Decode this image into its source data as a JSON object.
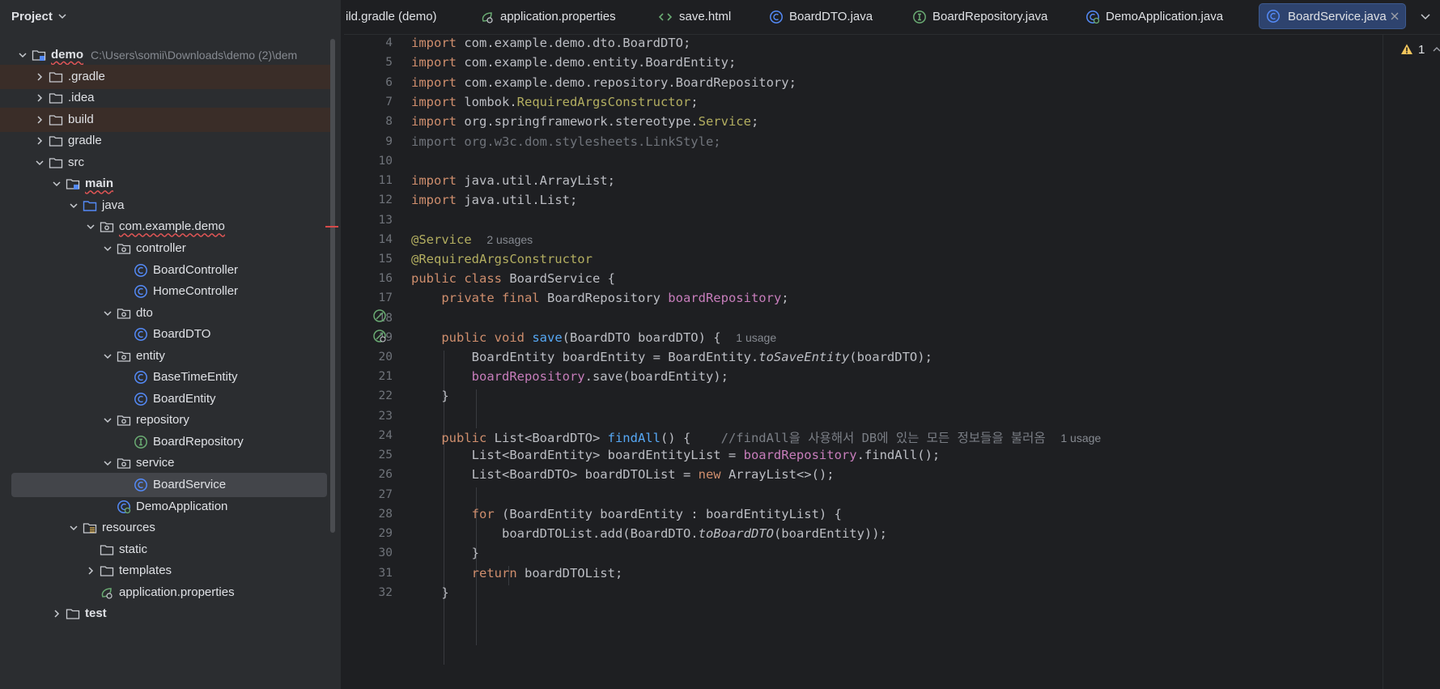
{
  "project_panel": {
    "title": "Project",
    "tree": [
      {
        "label": "demo",
        "path": "C:\\Users\\somii\\Downloads\\demo (2)\\dem",
        "icon": "module-folder-icon",
        "expanded": true
      },
      {
        "label": ".gradle",
        "icon": "folder-icon",
        "expanded": false
      },
      {
        "label": ".idea",
        "icon": "folder-icon",
        "expanded": false
      },
      {
        "label": "build",
        "icon": "folder-icon",
        "expanded": false
      },
      {
        "label": "gradle",
        "icon": "folder-icon",
        "expanded": false
      },
      {
        "label": "src",
        "icon": "folder-icon",
        "expanded": true
      },
      {
        "label": "main",
        "icon": "module-folder-icon",
        "expanded": true
      },
      {
        "label": "java",
        "icon": "source-folder-icon",
        "expanded": true
      },
      {
        "label": "com.example.demo",
        "icon": "package-icon",
        "expanded": true
      },
      {
        "label": "controller",
        "icon": "package-icon",
        "expanded": true
      },
      {
        "label": "BoardController",
        "icon": "class-icon"
      },
      {
        "label": "HomeController",
        "icon": "class-icon"
      },
      {
        "label": "dto",
        "icon": "package-icon",
        "expanded": true
      },
      {
        "label": "BoardDTO",
        "icon": "class-icon"
      },
      {
        "label": "entity",
        "icon": "package-icon",
        "expanded": true
      },
      {
        "label": "BaseTimeEntity",
        "icon": "class-icon"
      },
      {
        "label": "BoardEntity",
        "icon": "class-icon"
      },
      {
        "label": "repository",
        "icon": "package-icon",
        "expanded": true
      },
      {
        "label": "BoardRepository",
        "icon": "interface-icon"
      },
      {
        "label": "service",
        "icon": "package-icon",
        "expanded": true
      },
      {
        "label": "BoardService",
        "icon": "class-icon"
      },
      {
        "label": "DemoApplication",
        "icon": "spring-boot-class-icon"
      },
      {
        "label": "resources",
        "icon": "resources-folder-icon",
        "expanded": true
      },
      {
        "label": "static",
        "icon": "folder-icon"
      },
      {
        "label": "templates",
        "icon": "folder-icon",
        "expanded": false
      },
      {
        "label": "application.properties",
        "icon": "spring-properties-icon"
      },
      {
        "label": "test",
        "icon": "folder-icon",
        "expanded": false
      }
    ]
  },
  "tabs": [
    {
      "label": "ild.gradle (demo)",
      "icon": "gradle-icon"
    },
    {
      "label": "application.properties",
      "icon": "spring-properties-icon"
    },
    {
      "label": "save.html",
      "icon": "html-icon"
    },
    {
      "label": "BoardDTO.java",
      "icon": "class-icon"
    },
    {
      "label": "BoardRepository.java",
      "icon": "interface-icon"
    },
    {
      "label": "DemoApplication.java",
      "icon": "spring-boot-class-icon"
    },
    {
      "label": "BoardService.java",
      "icon": "class-icon",
      "active": true
    }
  ],
  "editor": {
    "line_numbers": [
      "4",
      "5",
      "6",
      "7",
      "8",
      "9",
      "10",
      "11",
      "12",
      "13",
      "14",
      "15",
      "16",
      "17",
      "18",
      "19",
      "20",
      "21",
      "22",
      "23",
      "24",
      "25",
      "26",
      "27",
      "28",
      "29",
      "30",
      "31",
      "32"
    ],
    "code": {
      "l4_kw": "import",
      "l4_rest": " com.example.demo.dto.BoardDTO;",
      "l5_kw": "import",
      "l5_rest": " com.example.demo.entity.BoardEntity;",
      "l6_kw": "import",
      "l6_rest": " com.example.demo.repository.BoardRepository;",
      "l7_kw": "import",
      "l7_a": " lombok.",
      "l7_b": "RequiredArgsConstructor",
      "l7_c": ";",
      "l8_kw": "import",
      "l8_a": " org.springframework.stereotype.",
      "l8_b": "Service",
      "l8_c": ";",
      "l9": "import org.w3c.dom.stylesheets.LinkStyle;",
      "l11_kw": "import",
      "l11_rest": " java.util.ArrayList;",
      "l12_kw": "import",
      "l12_rest": " java.util.List;",
      "l14_ann": "@Service",
      "l14_hint": "2 usages",
      "l15_ann": "@RequiredArgsConstructor",
      "l16_kw": "public class",
      "l16_rest": " BoardService {",
      "l17_kw": "private final",
      "l17_a": " BoardRepository ",
      "l17_fld": "boardRepository",
      "l17_c": ";",
      "l19_kw": "public void",
      "l19_fn": "save",
      "l19_rest": "(BoardDTO boardDTO) {",
      "l19_hint": "1 usage",
      "l20_a": "BoardEntity boardEntity = BoardEntity.",
      "l20_it": "toSaveEntity",
      "l20_c": "(boardDTO);",
      "l21_fld": "boardRepository",
      "l21_rest": ".save(boardEntity);",
      "l22": "}",
      "l24_kw": "public",
      "l24_a": " List<BoardDTO> ",
      "l24_fn": "findAll",
      "l24_b": "() {",
      "l24_cmt": "//findAll을 사용해서 DB에 있는 모든 정보들을 불러옴",
      "l24_hint": "1 usage",
      "l25_a": "List<BoardEntity> boardEntityList = ",
      "l25_fld": "boardRepository",
      "l25_c": ".findAll();",
      "l26_a": "List<BoardDTO> boardDTOList = ",
      "l26_kw": "new",
      "l26_c": " ArrayList<>();",
      "l28_kw": "for",
      "l28_rest": " (BoardEntity boardEntity : boardEntityList) {",
      "l29_a": "boardDTOList.add(BoardDTO.",
      "l29_it": "toBoardDTO",
      "l29_c": "(boardEntity));",
      "l30": "}",
      "l31_kw": "return",
      "l31_rest": " boardDTOList;",
      "l32": "}"
    }
  },
  "inspection": {
    "warning_count": "1"
  },
  "colors": {
    "editor_bg": "#1e1f22",
    "panel_bg": "#2b2d30",
    "keyword": "#cf8e6d",
    "annotation": "#b3ae60",
    "method": "#56a8f5",
    "field": "#c77dbb",
    "selection": "#43454a",
    "active_tab": "#2e436e"
  }
}
